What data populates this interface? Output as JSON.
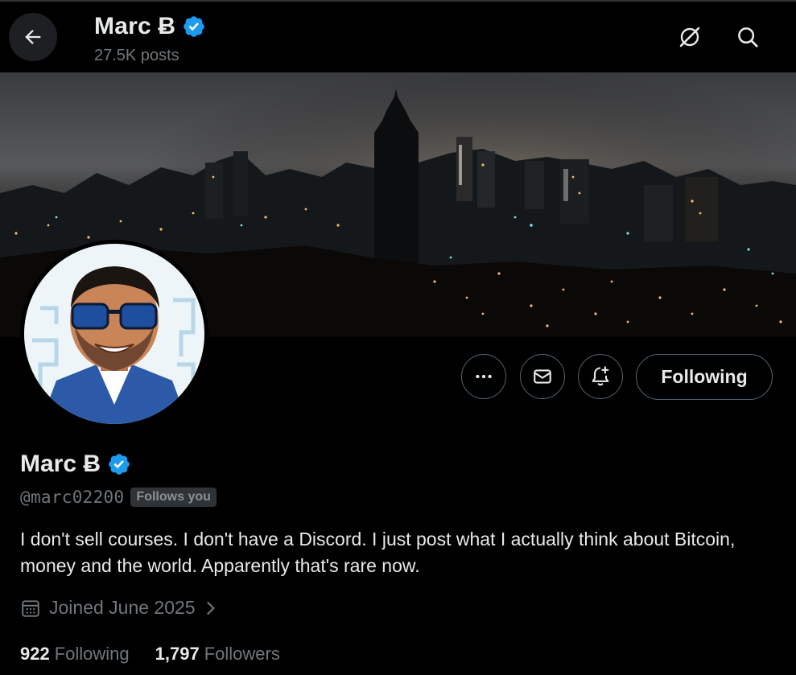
{
  "header": {
    "name": "Marc Ƀ",
    "posts": "27.5K posts"
  },
  "profile": {
    "name": "Marc Ƀ",
    "handle": "@marc02200",
    "follows_you": "Follows you",
    "bio": "I don't sell courses. I don't have a Discord. I just post what I actually think about Bitcoin, money and the world. Apparently that's rare now.",
    "joined": "Joined June 2025",
    "following_count": "922",
    "following_label": "Following",
    "followers_count": "1,797",
    "followers_label": "Followers"
  },
  "actions": {
    "following_button": "Following"
  },
  "icons": {
    "back": "arrow-left-icon",
    "grok": "grok-icon",
    "search": "search-icon",
    "more": "more-icon",
    "message": "message-icon",
    "notify": "bell-plus-icon",
    "verified": "verified-badge-icon",
    "calendar": "calendar-icon",
    "chevron": "chevron-right-icon"
  },
  "colors": {
    "background": "#000000",
    "text": "#e7e9ea",
    "secondary_text": "#71767b",
    "verified": "#1d9bf0",
    "border": "#536471"
  }
}
